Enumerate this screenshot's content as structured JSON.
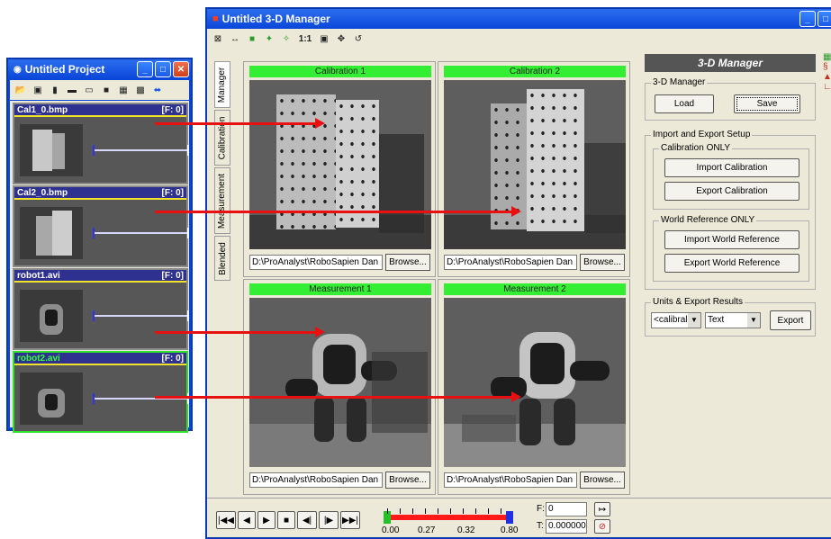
{
  "project": {
    "title": "Untitled Project",
    "clips": [
      {
        "name": "Cal1_0.bmp",
        "frame": "[F: 0]"
      },
      {
        "name": "Cal2_0.bmp",
        "frame": "[F: 0]"
      },
      {
        "name": "robot1.avi",
        "frame": "[F: 0]"
      },
      {
        "name": "robot2.avi",
        "frame": "[F: 0]"
      }
    ]
  },
  "manager": {
    "title": "Untitled 3-D Manager",
    "toolbar_zoom_label": "1:1",
    "tabs": [
      "Manager",
      "Calibration",
      "Measurement",
      "Blended"
    ],
    "panes": [
      {
        "title": "Calibration 1",
        "path": "D:\\ProAnalyst\\RoboSapien Dan",
        "browse": "Browse..."
      },
      {
        "title": "Calibration 2",
        "path": "D:\\ProAnalyst\\RoboSapien Dan",
        "browse": "Browse..."
      },
      {
        "title": "Measurement 1",
        "path": "D:\\ProAnalyst\\RoboSapien Dan",
        "browse": "Browse..."
      },
      {
        "title": "Measurement 2",
        "path": "D:\\ProAnalyst\\RoboSapien Dan",
        "browse": "Browse..."
      }
    ],
    "panel": {
      "header": "3-D Manager",
      "group_manager": "3-D Manager",
      "load": "Load",
      "save": "Save",
      "group_import_export": "Import and Export Setup",
      "group_calibration_only": "Calibration ONLY",
      "import_calibration": "Import Calibration",
      "export_calibration": "Export Calibration",
      "group_world_reference_only": "World Reference ONLY",
      "import_world_reference": "Import World Reference",
      "export_world_reference": "Export World Reference",
      "group_units_export": "Units & Export Results",
      "units_select": "<calibral",
      "format_select": "Text",
      "export": "Export"
    },
    "playback": {
      "ticks": [
        "0.00",
        "0.27",
        "0.32",
        "0.80"
      ],
      "frame_label": "F:",
      "frame_value": "0",
      "time_label": "T:",
      "time_value": "0.000000"
    }
  },
  "colors": {
    "title_bar": "#0a46d8",
    "pane_header": "#33ee33",
    "arrow": "#e81010",
    "clip_header": "#2e3190"
  }
}
